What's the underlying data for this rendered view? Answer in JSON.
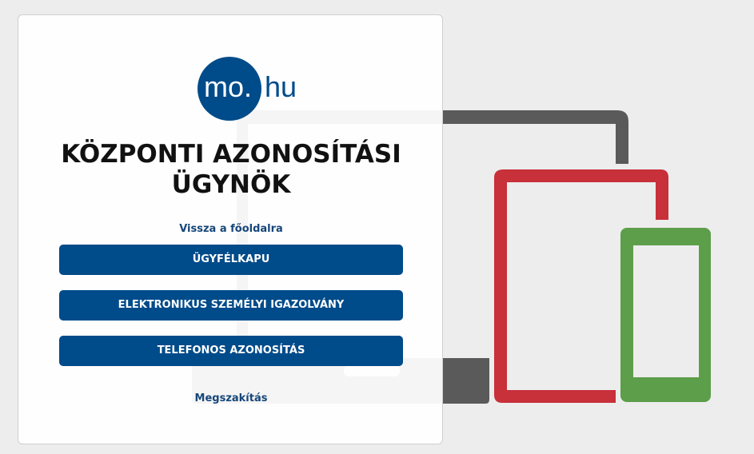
{
  "logo": {
    "text_a": "mo.",
    "text_b": "hu",
    "brand_color": "#004b8a"
  },
  "title_line1": "KÖZPONTI AZONOSÍTÁSI",
  "title_line2": "ÜGYNÖK",
  "back_link": "Vissza a főoldalra",
  "buttons": [
    {
      "label": "ÜGYFÉLKAPU"
    },
    {
      "label": "ELEKTRONIKUS SZEMÉLYI IGAZOLVÁNY"
    },
    {
      "label": "TELEFONOS AZONOSÍTÁS"
    }
  ],
  "cancel_link": "Megszakítás",
  "colors": {
    "primary": "#004b8a",
    "laptop": "#555555",
    "tablet": "#c8303a",
    "phone": "#5d9e4a"
  }
}
